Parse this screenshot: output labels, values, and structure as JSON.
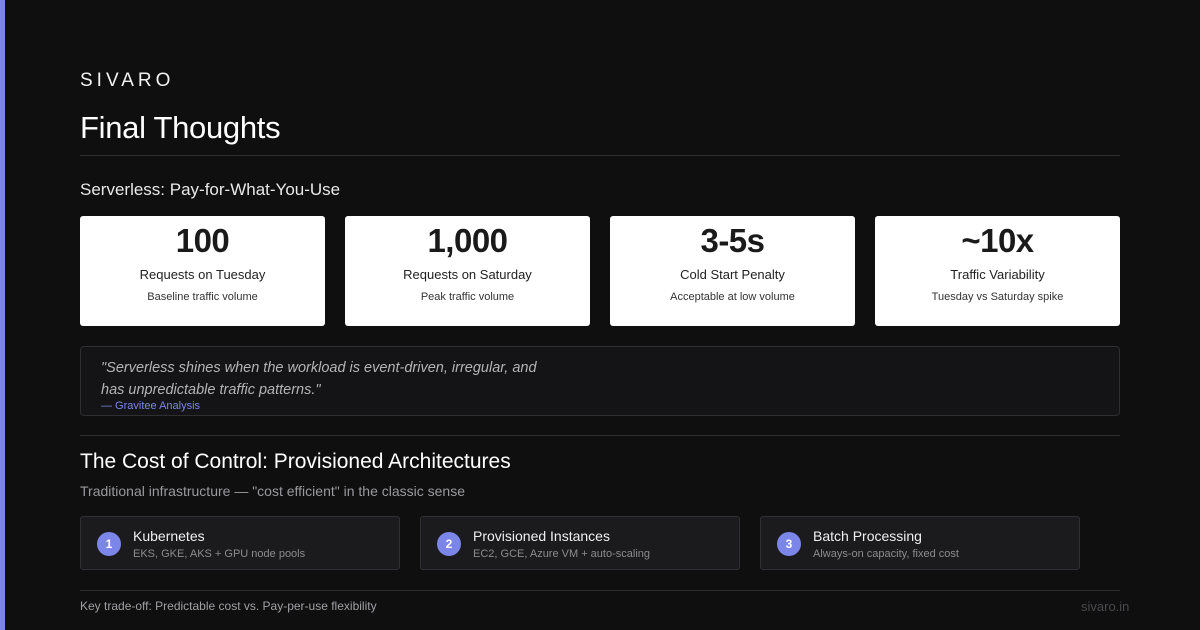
{
  "brand": "SIVARO",
  "title": "Final Thoughts",
  "serverless": {
    "heading": "Serverless: Pay-for-What-You-Use",
    "stats": [
      {
        "value": "100",
        "label": "Requests on Tuesday",
        "desc": "Baseline traffic volume"
      },
      {
        "value": "1,000",
        "label": "Requests on Saturday",
        "desc": "Peak traffic volume"
      },
      {
        "value": "3-5s",
        "label": "Cold Start Penalty",
        "desc": "Acceptable at low volume"
      },
      {
        "value": "~10x",
        "label": "Traffic Variability",
        "desc": "Tuesday vs Saturday spike"
      }
    ],
    "quote": {
      "text": "\"Serverless shines when the workload is event-driven, irregular, and has unpredictable traffic patterns.\"",
      "source": "— Gravitee Analysis"
    }
  },
  "provisioned": {
    "heading": "The Cost of Control: Provisioned Architectures",
    "subheading": "Traditional infrastructure — \"cost efficient\" in the classic sense",
    "options": [
      {
        "number": "1",
        "title": "Kubernetes",
        "desc": "EKS, GKE, AKS + GPU node pools"
      },
      {
        "number": "2",
        "title": "Provisioned Instances",
        "desc": "EC2, GCE, Azure VM + auto-scaling"
      },
      {
        "number": "3",
        "title": "Batch Processing",
        "desc": "Always-on capacity, fixed cost"
      }
    ]
  },
  "footer": {
    "note": "Key trade-off: Predictable cost vs. Pay-per-use flexibility",
    "url": "sivaro.in"
  },
  "colors": {
    "background": "#0f0f10",
    "accent": "#7b86e8",
    "card": "#ffffff"
  }
}
